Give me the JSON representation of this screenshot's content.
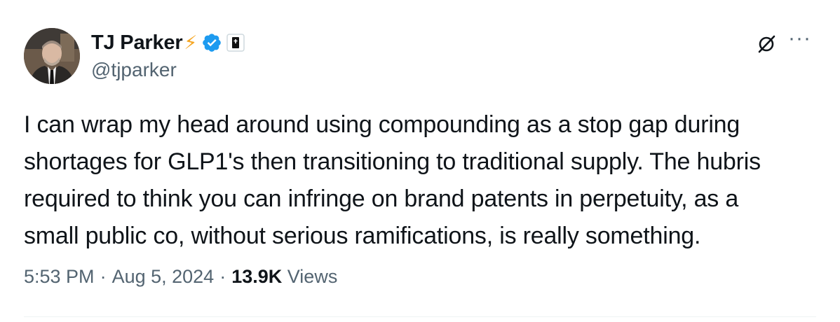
{
  "author": {
    "display_name": "TJ Parker",
    "emoji": "⚡",
    "handle": "@tjparker",
    "verified_badge_color": "#1d9bf0"
  },
  "tweet": {
    "lines": [
      "I can wrap my head around using compounding as a stop gap during",
      "shortages for GLP1's then transitioning to traditional supply. The hubris",
      "required to think you can infringe on brand patents in perpetuity, as a",
      "small public co, without serious ramifications, is really something."
    ]
  },
  "meta": {
    "time": "5:53 PM",
    "date": "Aug 5, 2024",
    "separator": "·",
    "views_count": "13.9K",
    "views_label": "Views"
  },
  "actions": {
    "more_label": "···",
    "grok_icon": "grok-icon"
  },
  "colors": {
    "secondary_text": "#536471",
    "primary_text": "#0f1419",
    "bolt": "#f5a623"
  }
}
